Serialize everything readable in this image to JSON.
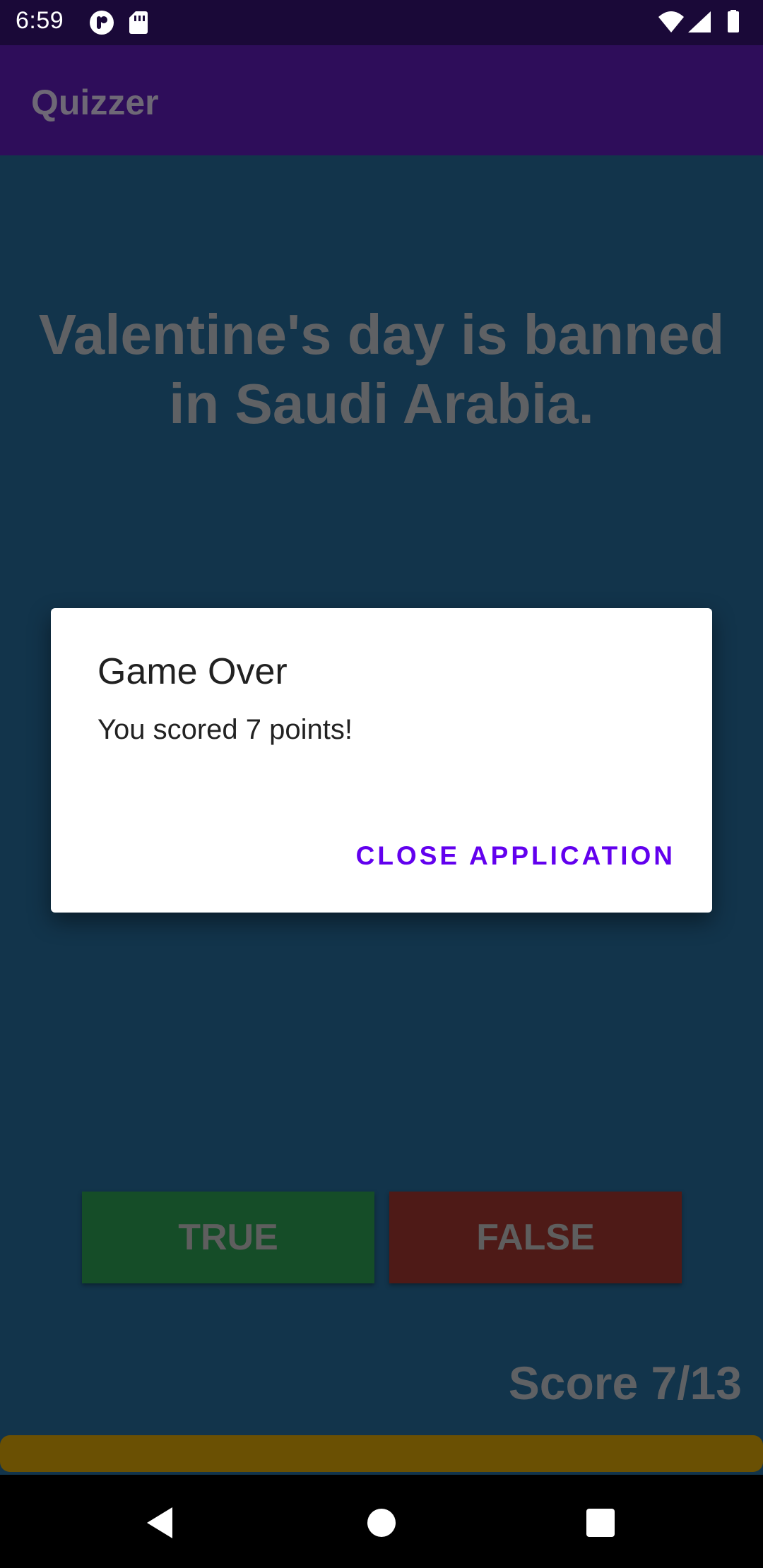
{
  "status_bar": {
    "time": "6:59",
    "left_icons": [
      "pocket-icon",
      "sd-card-icon"
    ],
    "right_icons": [
      "wifi-icon",
      "signal-icon",
      "battery-icon"
    ]
  },
  "app_bar": {
    "title": "Quizzer"
  },
  "quiz": {
    "question": "Valentine's day is banned in Saudi Arabia.",
    "true_label": "TRUE",
    "false_label": "FALSE",
    "score_text": "Score 7/13",
    "progress_fraction": 1.0
  },
  "dialog": {
    "title": "Game Over",
    "message": "You scored 7 points!",
    "action_label": "CLOSE APPLICATION"
  },
  "nav_bar": {
    "buttons": [
      "back-icon",
      "home-icon",
      "recents-icon"
    ]
  },
  "colors": {
    "app_bar": "#2e0d5a",
    "background": "#12344b",
    "true_button": "#154d28",
    "false_button": "#4e1a17",
    "progress": "#6a5003",
    "accent": "#6200ee"
  }
}
